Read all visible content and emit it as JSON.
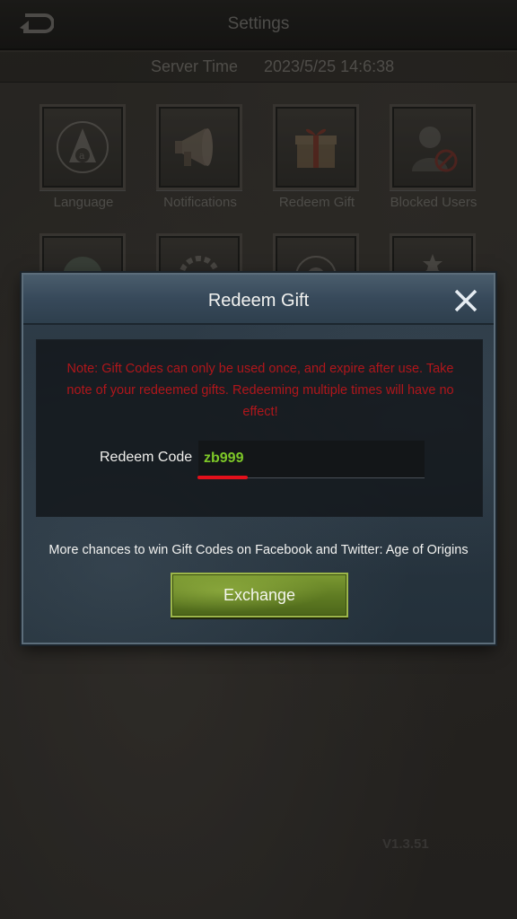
{
  "header": {
    "title": "Settings",
    "back_icon": "back-arrow-icon"
  },
  "server": {
    "label": "Server Time",
    "value": "2023/5/25 14:6:38"
  },
  "settings_tiles": [
    {
      "label": "Language",
      "icon": "language-icon"
    },
    {
      "label": "Notifications",
      "icon": "megaphone-icon"
    },
    {
      "label": "Redeem Gift",
      "icon": "gift-icon"
    },
    {
      "label": "Blocked Users",
      "icon": "blocked-user-icon"
    },
    {
      "label": "",
      "icon": "globe-icon"
    },
    {
      "label": "",
      "icon": "gear-icon"
    },
    {
      "label": "",
      "icon": "badge-icon"
    },
    {
      "label": "",
      "icon": "rank-icon"
    }
  ],
  "version": "V1.3.51",
  "modal": {
    "title": "Redeem Gift",
    "close_icon": "close-icon",
    "note": "Note: Gift Codes can only be used once, and expire after use. Take note of your redeemed gifts. Redeeming multiple times will have no effect!",
    "code_label": "Redeem Code",
    "code_value": "zb999",
    "info": "More chances to win Gift Codes on Facebook and Twitter: Age of Origins",
    "exchange_label": "Exchange"
  },
  "colors": {
    "note_red": "#b0161b",
    "code_green": "#7ec928",
    "button_green": "#5e7a22",
    "annotation_red": "#e3101b"
  }
}
